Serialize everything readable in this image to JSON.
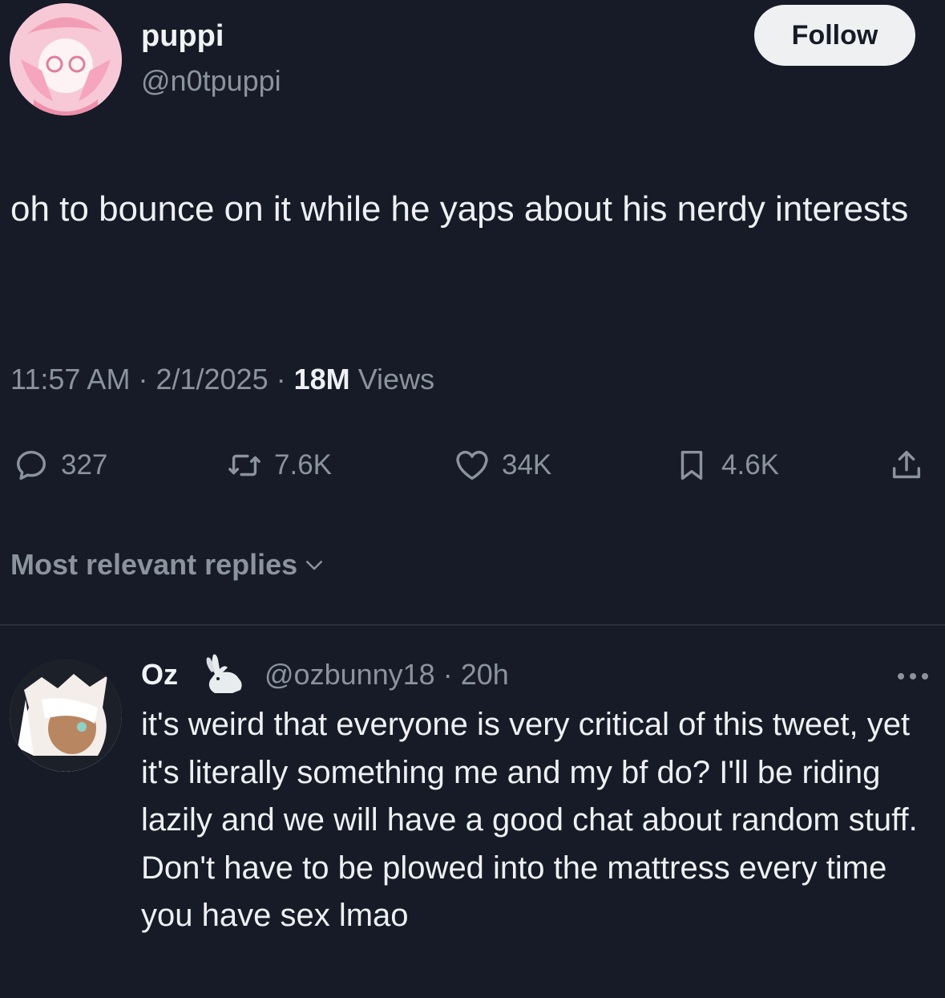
{
  "tweet": {
    "author": {
      "display_name": "puppi",
      "handle": "@n0tpuppi"
    },
    "follow_label": "Follow",
    "text": "oh to bounce on it while he yaps about his nerdy interests",
    "time": "11:57 AM",
    "date": "2/1/2025",
    "views_count": "18M",
    "views_label": "Views",
    "separator": "·",
    "stats": {
      "replies": "327",
      "retweets": "7.6K",
      "likes": "34K",
      "bookmarks": "4.6K"
    },
    "icons": [
      "reply-icon",
      "retweet-icon",
      "heart-icon",
      "bookmark-icon",
      "share-icon"
    ]
  },
  "replies_sort": {
    "label": "Most relevant replies",
    "icon": "chevron-down-icon"
  },
  "reply": {
    "display_name": "Oz",
    "badge_icon": "bunny-icon",
    "handle": "@ozbunny18",
    "time": "20h",
    "separator": "·",
    "more_icon": "more-icon",
    "text": "it's weird that everyone is very critical of this tweet, yet it's literally something me and my bf do? I'll be riding lazily and we will have a good chat about random stuff. Don't have to be plowed into the mattress every time you have sex lmao"
  },
  "colors": {
    "background": "#161b27",
    "text_primary": "#eef0f3",
    "text_secondary": "#8b939d",
    "follow_button_bg": "#eef0f2"
  }
}
